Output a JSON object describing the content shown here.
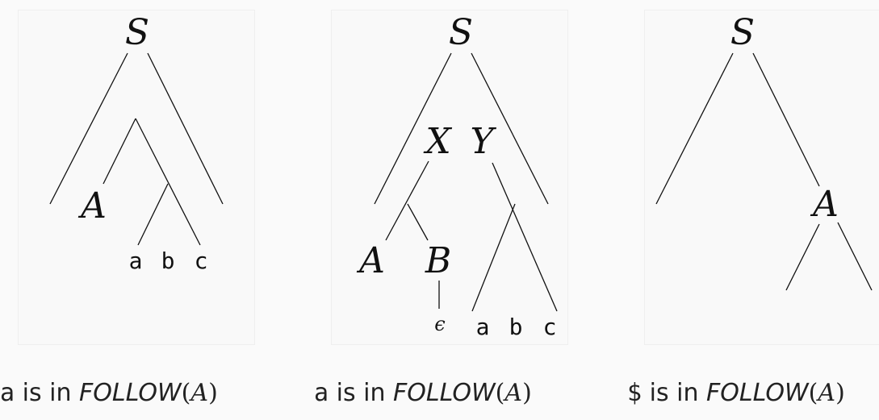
{
  "diagrams": [
    {
      "root": "S",
      "nonterminal": "A",
      "terminals": [
        "a",
        "b",
        "c"
      ],
      "caption": {
        "symbol": "a",
        "text": "is in",
        "func": "FOLLOW",
        "arg": "A"
      }
    },
    {
      "root": "S",
      "nonterminals": [
        "X",
        "Y",
        "A",
        "B"
      ],
      "epsilon": "ϵ",
      "terminals": [
        "a",
        "b",
        "c"
      ],
      "caption": {
        "symbol": "a",
        "text": "is in",
        "func": "FOLLOW",
        "arg": "A"
      }
    },
    {
      "root": "S",
      "nonterminal": "A",
      "caption": {
        "symbol": "$",
        "text": "is in",
        "func": "FOLLOW",
        "arg": "A"
      }
    }
  ]
}
